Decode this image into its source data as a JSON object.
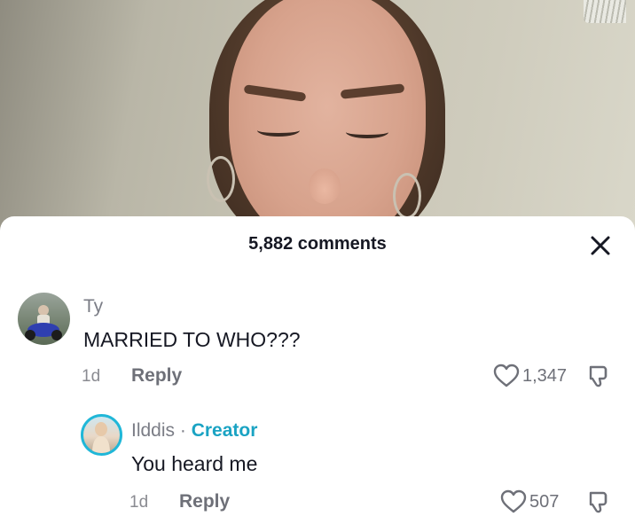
{
  "sheet": {
    "title": "5,882 comments"
  },
  "comments": [
    {
      "username": "Ty",
      "text": "MARRIED TO WHO???",
      "time": "1d",
      "reply_label": "Reply",
      "likes": "1,347"
    },
    {
      "username": "Ilddis",
      "separator": "·",
      "badge": "Creator",
      "text": "You heard me",
      "time": "1d",
      "reply_label": "Reply",
      "likes": "507"
    }
  ],
  "colors": {
    "creator_badge": "#1aa3c3",
    "text": "#161823",
    "muted": "#6e7078"
  }
}
